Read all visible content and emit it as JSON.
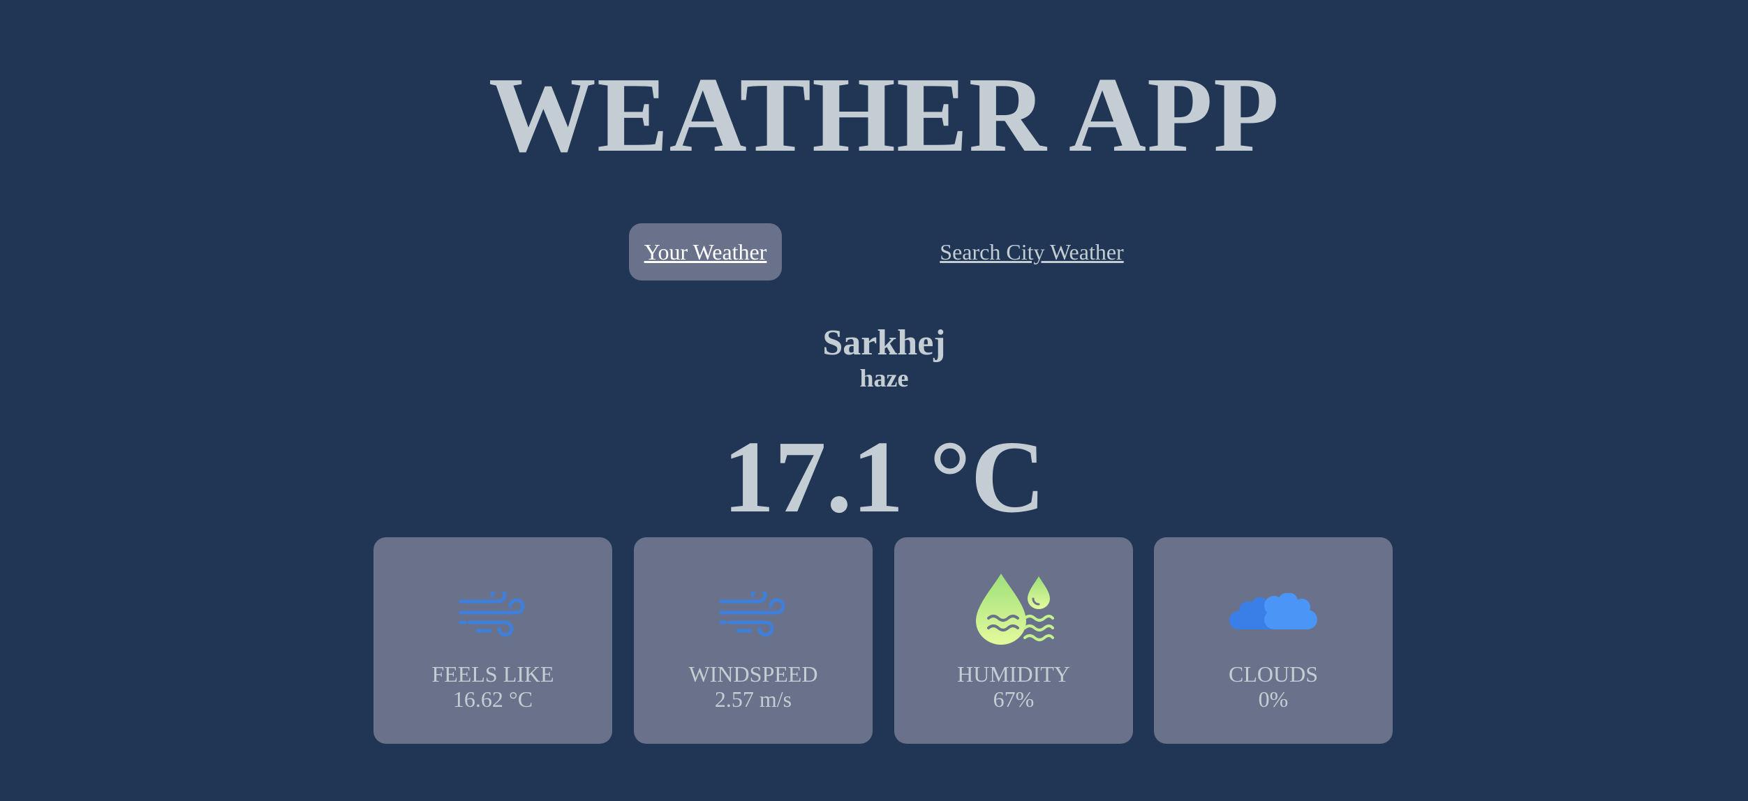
{
  "app": {
    "title": "WEATHER APP"
  },
  "tabs": [
    {
      "label": "Your Weather",
      "active": true
    },
    {
      "label": "Search City Weather",
      "active": false
    }
  ],
  "weather": {
    "location": "Sarkhej",
    "description": "haze",
    "temperature": "17.1 °C"
  },
  "cards": [
    {
      "label": "FEELS LIKE",
      "value": "16.62 °C",
      "icon": "wind-icon"
    },
    {
      "label": "WINDSPEED",
      "value": "2.57 m/s",
      "icon": "wind-icon"
    },
    {
      "label": "HUMIDITY",
      "value": "67%",
      "icon": "humidity-icon"
    },
    {
      "label": "CLOUDS",
      "value": "0%",
      "icon": "cloud-icon"
    }
  ],
  "colors": {
    "background": "#213555",
    "card": "#69728a",
    "text": "#c3cdd3",
    "wind_icon": "#3d7fdb",
    "humidity_icon": "#c4f28c",
    "cloud_icon": "#3f8cf5"
  }
}
